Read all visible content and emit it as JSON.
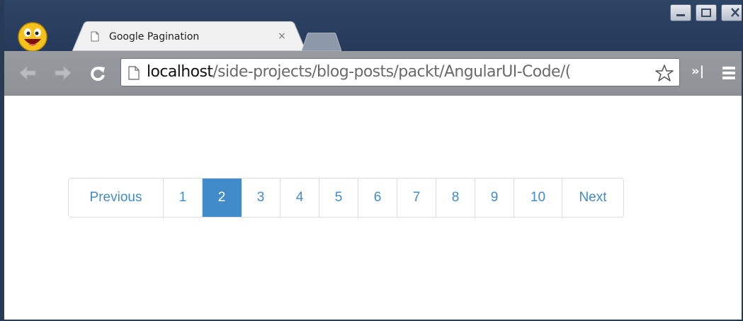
{
  "browser": {
    "tab_title": "Google Pagination",
    "tab_close": "×",
    "url_host": "localhost",
    "url_path": "/side-projects/blog-posts/packt/AngularUI-Code/(",
    "extensions_label": "»|"
  },
  "icons": {
    "avatar": "smiley-avatar-icon",
    "back": "back-arrow-icon",
    "forward": "forward-arrow-icon",
    "reload": "reload-icon",
    "star": "star-icon",
    "menu": "hamburger-menu-icon"
  },
  "pagination": {
    "previous_label": "Previous",
    "next_label": "Next",
    "pages": [
      "1",
      "2",
      "3",
      "4",
      "5",
      "6",
      "7",
      "8",
      "9",
      "10"
    ],
    "active_page": "2"
  },
  "colors": {
    "accent": "#428bca",
    "titlebar": "#2e4465",
    "toolbar": "#979b9f"
  }
}
